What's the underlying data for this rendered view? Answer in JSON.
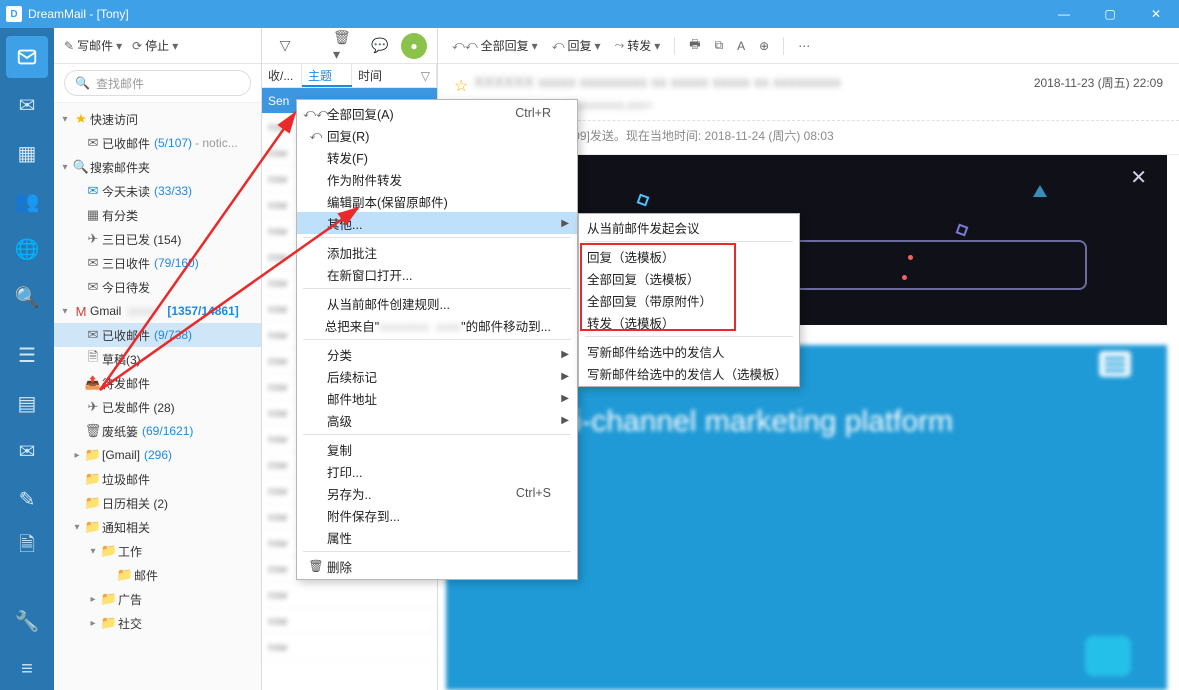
{
  "title": "DreamMail - [Tony]",
  "toolbar": {
    "compose": "写邮件",
    "stop": "停止"
  },
  "search_placeholder": "查找邮件",
  "tree": {
    "quick": {
      "title": "快速访问",
      "inbox": "已收邮件",
      "inbox_count": "(5/107)",
      "inbox_suffix": "- notic..."
    },
    "searchFolders": {
      "title": "搜索邮件夹",
      "todayUnread": "今天未读",
      "todayUnread_count": "(33/33)",
      "categorized": "有分类",
      "sent3": "三日已发 (154)",
      "recv3": "三日收件",
      "recv3_count": "(79/160)",
      "todayPending": "今日待发"
    },
    "gmail": {
      "title": "Gmail",
      "title_count": "[1357/14861]",
      "inbox": "已收邮件",
      "inbox_count": "(9/738)",
      "drafts": "草稿(3)",
      "outbox": "待发邮件",
      "sent": "已发邮件 (28)",
      "trash": "废纸篓",
      "trash_count": "(69/1621)",
      "gmailFolder": "[Gmail]",
      "gmailFolder_count": "(296)",
      "spam": "垃圾邮件",
      "calendar": "日历相关 (2)",
      "notify": "通知相关",
      "work": "工作",
      "mail": "邮件",
      "ads": "广告",
      "social": "社交"
    }
  },
  "listHeaders": {
    "recv": "收/...",
    "subject": "主题",
    "time": "时间"
  },
  "listFirst": "Sen",
  "readerToolbar": {
    "replyAll": "全部回复",
    "reply": "回复",
    "forward": "转发"
  },
  "readerDate": "2018-11-23 (周五) 22:09",
  "readerMeta": "[2018-11-23 (周五) 14:09]发送。现在当地时间: 2018-11-24 (周六) 08:03",
  "heroTitle": "Multi-channel marketing platform",
  "menu": {
    "replyAll": "全部回复(A)",
    "replyAll_accel": "Ctrl+R",
    "reply": "回复(R)",
    "forward": "转发(F)",
    "forwardAttach": "作为附件转发",
    "editCopy": "编辑副本(保留原邮件)",
    "other": "其他...",
    "addAnno": "添加批注",
    "newWin": "在新窗口打开...",
    "createRule": "从当前邮件创建规则...",
    "moveTo_pre": "总把来自\"",
    "moveTo_suf": "\"的邮件移动到...",
    "classify": "分类",
    "followup": "后续标记",
    "mailAddr": "邮件地址",
    "advanced": "高级",
    "copy": "复制",
    "print": "打印...",
    "saveAs": "另存为..",
    "saveAs_accel": "Ctrl+S",
    "saveAttach": "附件保存到...",
    "props": "属性",
    "delete": "删除"
  },
  "submenu": {
    "startMeeting": "从当前邮件发起会议",
    "replyTpl": "回复（选模板）",
    "replyAllTpl": "全部回复（选模板）",
    "replyAllAttach": "全部回复（带原附件）",
    "forwardTpl": "转发（选模板）",
    "newToSel": "写新邮件给选中的发信人",
    "newToSelTpl": "写新邮件给选中的发信人（选模板）"
  }
}
